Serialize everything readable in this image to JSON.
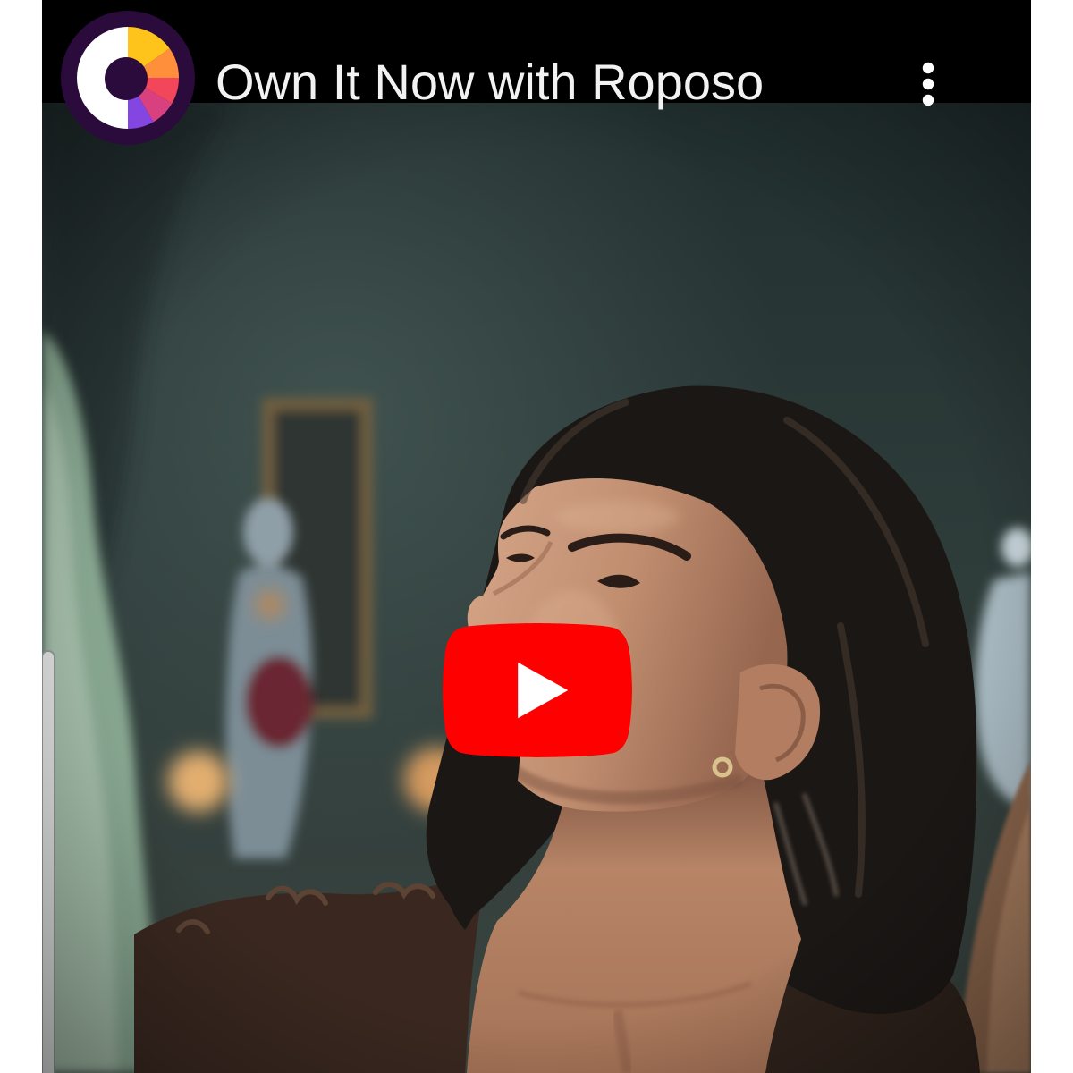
{
  "player": {
    "title": "Own It Now with Roposo",
    "channel_avatar": {
      "icon": "roposo-logo-icon",
      "colors": [
        "#2B0B3C",
        "#FFFFFF",
        "#FFC41C",
        "#FF8F3A",
        "#F2475B",
        "#D8407F",
        "#8446E0"
      ]
    },
    "menu": {
      "icon": "more-vert-icon",
      "color": "#FFFFFF"
    },
    "play_button": {
      "icon": "youtube-play-icon",
      "color": "#FF0000",
      "glyph_color": "#FFFFFF"
    },
    "colors": {
      "top_bar": "#000000",
      "title_text": "#FFFFFF",
      "page_background": "#FFFFFF"
    }
  }
}
